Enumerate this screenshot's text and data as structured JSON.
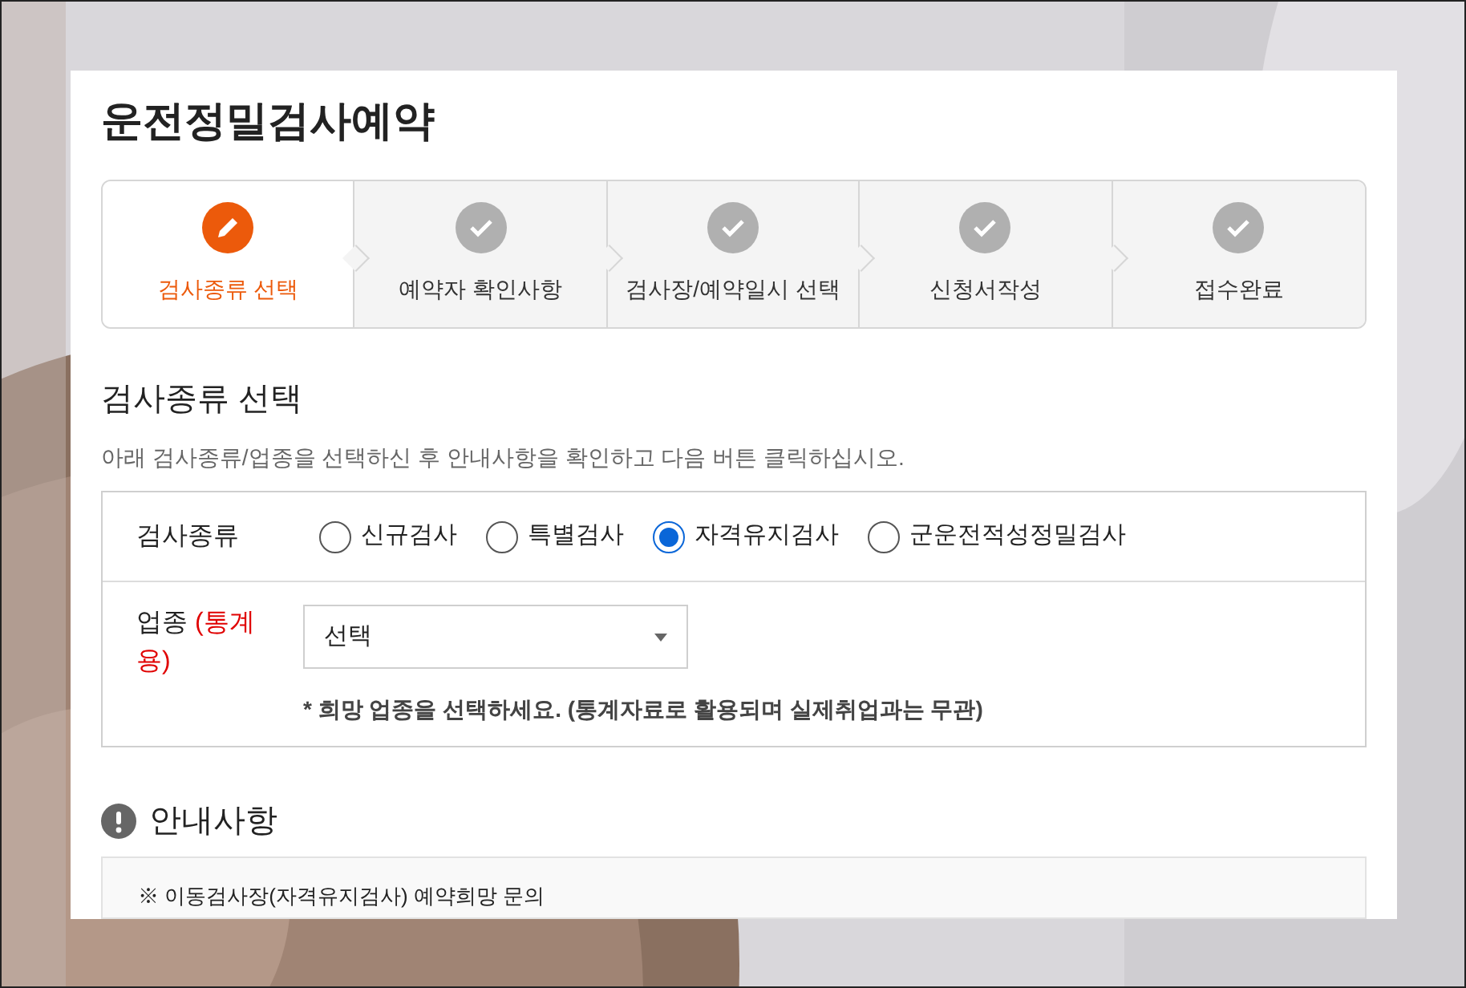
{
  "title": "운전정밀검사예약",
  "steps": [
    {
      "label": "검사종류 선택",
      "selected": true
    },
    {
      "label": "예약자 확인사항",
      "selected": false
    },
    {
      "label": "검사장/예약일시 선택",
      "selected": false
    },
    {
      "label": "신청서작성",
      "selected": false
    },
    {
      "label": "접수완료",
      "selected": false
    }
  ],
  "section": {
    "title": "검사종류 선택",
    "description": "아래 검사종류/업종을 선택하신 후 안내사항을 확인하고 다음 버튼 클릭하십시오."
  },
  "exam_type": {
    "label": "검사종류",
    "options": [
      {
        "label": "신규검사",
        "selected": false
      },
      {
        "label": "특별검사",
        "selected": false
      },
      {
        "label": "자격유지검사",
        "selected": true
      },
      {
        "label": "군운전적성정밀검사",
        "selected": false
      }
    ]
  },
  "industry": {
    "label": "업종",
    "note": "(통계용)",
    "select": {
      "value": "선택"
    },
    "hint": "* 희망 업종을 선택하세요. (통계자료로 활용되며 실제취업과는 무관)"
  },
  "notice": {
    "title": "안내사항",
    "lines": [
      "※ 이동검사장(자격유지검사) 예약희망 문의"
    ]
  }
}
